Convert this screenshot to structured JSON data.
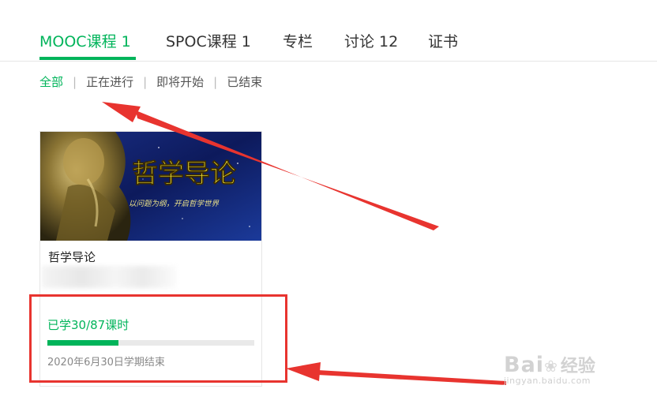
{
  "tabs": [
    {
      "label": "MOOC课程 1",
      "active": true
    },
    {
      "label": "SPOC课程 1",
      "active": false
    },
    {
      "label": "专栏",
      "active": false
    },
    {
      "label": "讨论 12",
      "active": false
    },
    {
      "label": "证书",
      "active": false
    }
  ],
  "filters": [
    {
      "label": "全部",
      "active": true
    },
    {
      "label": "正在进行",
      "active": false
    },
    {
      "label": "即将开始",
      "active": false
    },
    {
      "label": "已结束",
      "active": false
    }
  ],
  "course": {
    "cover_title": "哲学导论",
    "cover_subtitle": "以问题为纲，开启哲学世界",
    "title": "哲学导论",
    "progress_text": "已学30/87课时",
    "progress_fraction": 0.345,
    "term_end": "2020年6月30日学期结束"
  },
  "watermark": {
    "brand": "Bai",
    "brand_suffix": "经验",
    "url": "jingyan.baidu.com"
  },
  "colors": {
    "accent": "#00b45a",
    "annotation": "#e8342f"
  }
}
